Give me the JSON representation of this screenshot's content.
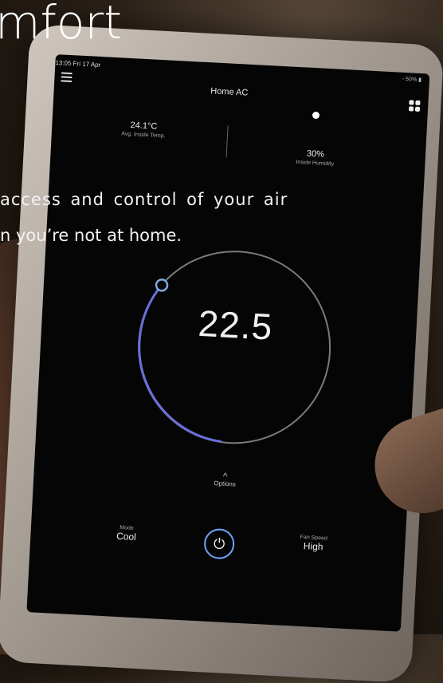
{
  "overlay": {
    "title_partial": "mfort",
    "line1": "access and control of your air",
    "line2": "n you’re not at home."
  },
  "status": {
    "time_date": "13:05  Fri 17 Apr",
    "battery": "50%"
  },
  "device": {
    "title": "Home AC"
  },
  "stats": {
    "inside_temp": {
      "value": "24.1°C",
      "label": "Avg. Inside Temp."
    },
    "humidity": {
      "value": "30%",
      "label": "Inside Humidity"
    }
  },
  "dial": {
    "setpoint": "22.5"
  },
  "options": {
    "label": "Options"
  },
  "mode": {
    "label": "Mode",
    "value": "Cool"
  },
  "fan": {
    "label": "Fan Speed",
    "value": "High"
  },
  "colors": {
    "accent": "#6fa3ff"
  }
}
